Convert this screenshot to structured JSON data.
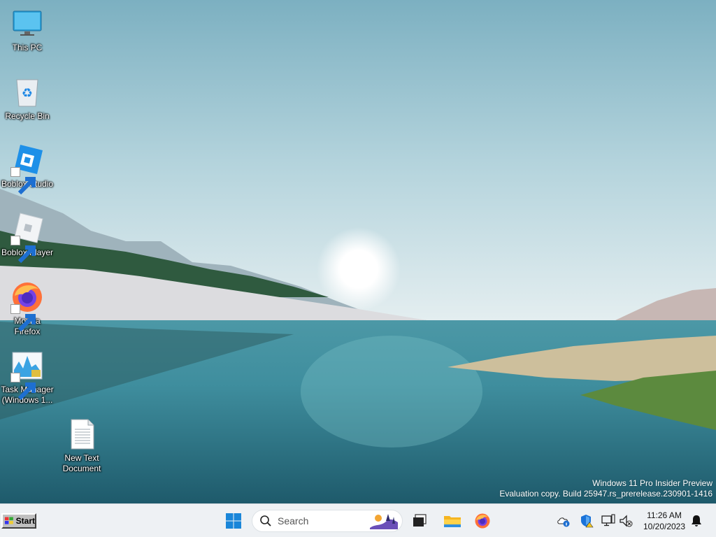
{
  "desktop": {
    "icons": [
      {
        "label": "This PC",
        "icon": "this-pc-icon"
      },
      {
        "label": "Recycle Bin",
        "icon": "recycle-bin-icon"
      },
      {
        "label": "Boblox Studio",
        "icon": "boblox-studio-icon"
      },
      {
        "label": "Boblox Player",
        "icon": "boblox-player-icon"
      },
      {
        "label": "Mozilla Firefox",
        "icon": "firefox-icon"
      },
      {
        "label": "Task Manager (Windows 1...",
        "icon": "task-manager-icon"
      },
      {
        "label": "New Text Document",
        "icon": "text-document-icon"
      }
    ],
    "watermark": {
      "line1": "Windows 11 Pro Insider Preview",
      "line2": "Evaluation copy. Build 25947.rs_prerelease.230901-1416"
    }
  },
  "taskbar": {
    "start_label": "Start",
    "search_placeholder": "Search",
    "pinned": [
      "windows-logo-icon",
      "task-view-icon",
      "file-explorer-icon",
      "firefox-icon"
    ],
    "tray": [
      "onedrive-icon",
      "windows-security-icon",
      "network-icon",
      "volume-icon"
    ],
    "time": "11:26 AM",
    "date": "10/20/2023",
    "accent": "#0078d4"
  }
}
